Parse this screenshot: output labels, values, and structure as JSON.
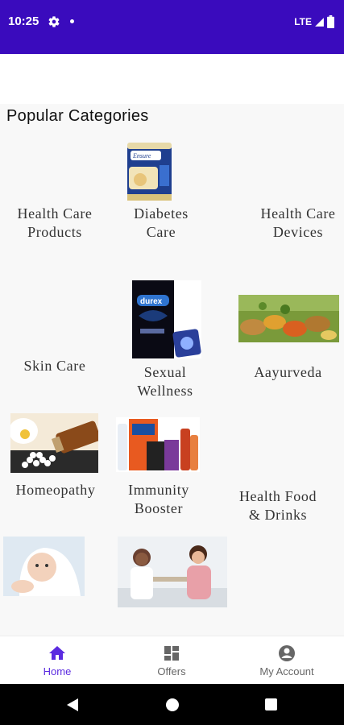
{
  "status_bar": {
    "time": "10:25",
    "network": "LTE",
    "icons": [
      "gear-icon",
      "notification-dot-icon",
      "signal-icon",
      "battery-icon"
    ],
    "color": "#3a0bbd"
  },
  "section": {
    "title": "Popular Categories"
  },
  "categories": [
    {
      "label": "Health Care\nProducts",
      "image": "none"
    },
    {
      "label": "Diabetes\nCare",
      "image": "nutrition-supplement-can"
    },
    {
      "label": "Health Care\nDevices",
      "image": "none"
    },
    {
      "label": "Skin Care",
      "image": "none"
    },
    {
      "label": "Sexual\nWellness",
      "image": "condom-pack"
    },
    {
      "label": "Aayurveda",
      "image": "ayurvedic-herbs"
    },
    {
      "label": "Homeopathy",
      "image": "homeopathy-pills-bottle"
    },
    {
      "label": "Immunity\nBooster",
      "image": "immunity-products"
    },
    {
      "label": "Health Food\n& Drinks",
      "image": "none"
    },
    {
      "label": "",
      "image": "baby-in-towel"
    },
    {
      "label": "",
      "image": "doctor-consultation"
    }
  ],
  "bottom_nav": {
    "items": [
      {
        "label": "Home",
        "icon": "home-icon",
        "active": true
      },
      {
        "label": "Offers",
        "icon": "offers-grid-icon",
        "active": false
      },
      {
        "label": "My Account",
        "icon": "account-icon",
        "active": false
      }
    ],
    "active_color": "#5b2be0"
  },
  "system_nav": {
    "icons": [
      "back-icon",
      "home-circle-icon",
      "recents-icon"
    ]
  }
}
